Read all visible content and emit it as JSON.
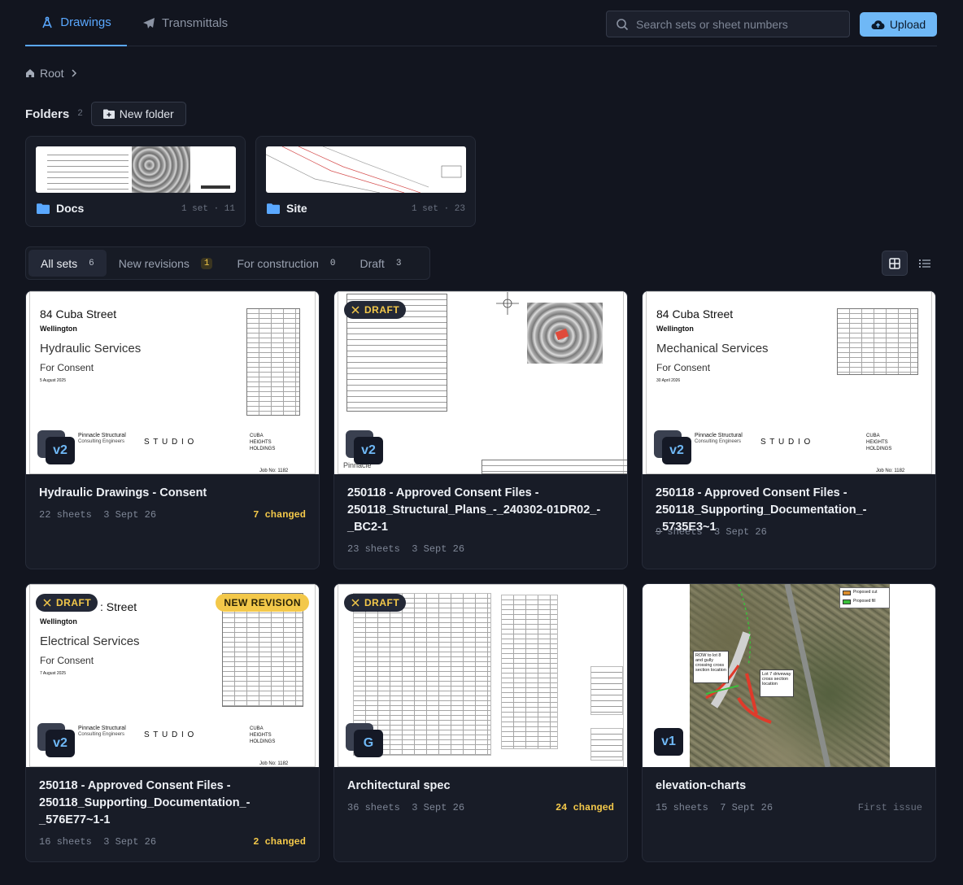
{
  "tabs": [
    {
      "label": "Drawings",
      "icon": "compass-icon",
      "active": true
    },
    {
      "label": "Transmittals",
      "icon": "paper-plane-icon",
      "active": false
    }
  ],
  "search": {
    "placeholder": "Search sets or sheet numbers"
  },
  "upload": {
    "label": "Upload"
  },
  "breadcrumb": {
    "root": "Root"
  },
  "folders": {
    "title": "Folders",
    "count": "2",
    "new_folder_label": "New folder",
    "items": [
      {
        "name": "Docs",
        "meta": "1 set · 11"
      },
      {
        "name": "Site",
        "meta": "1 set · 23"
      }
    ]
  },
  "filters": [
    {
      "label": "All sets",
      "count": "6",
      "active": true
    },
    {
      "label": "New revisions",
      "count": "1",
      "active": false
    },
    {
      "label": "For construction",
      "count": "0",
      "active": false
    },
    {
      "label": "Draft",
      "count": "3",
      "active": false
    }
  ],
  "badges": {
    "draft": "DRAFT",
    "new_revision": "NEW REVISION"
  },
  "sheet_text": {
    "address": "84 Cuba Street",
    "address_partial": ": Street",
    "city": "Wellington",
    "for_consent": "For Consent",
    "date_hyd": "5 August 2025",
    "date_mech": "30 April 2026",
    "date_elec": "7 August 2025",
    "hydraulic": "Hydraulic Services",
    "mechanical": "Mechanical Services",
    "electrical": "Electrical Services",
    "pinnacle": "Pinnacle Structural",
    "consulting": "Consulting Engineers",
    "studio": "S T U D I O",
    "cuba1": "CUBA",
    "cuba2": "HEIGHTS",
    "cuba3": "HOLDINGS",
    "job": "Job No: 1182",
    "pinnacle_short": "Pinnacle",
    "proposed_cut": "Proposed cut",
    "proposed_fill": "Proposed fill",
    "row_note": "ROW to lot 8 and gully crossing cross section location",
    "lot_note": "Lot 7 driveway cross section location"
  },
  "cards": [
    {
      "title": "Hydraulic Drawings - Consent",
      "sheets": "22 sheets",
      "date": "3 Sept 26",
      "changed": "7 changed",
      "version": "v2"
    },
    {
      "title": "250118 - Approved Consent Files - 250118_Structural_Plans_-_240302-01DR02_-_BC2-1",
      "sheets": "23 sheets",
      "date": "3 Sept 26",
      "changed": "",
      "version": "v2"
    },
    {
      "title": "250118 - Approved Consent Files - 250118_Supporting_Documentation_-_5735E3~1",
      "sheets": "9 sheets",
      "date": "3 Sept 26",
      "changed": "",
      "version": "v2"
    },
    {
      "title": "250118 - Approved Consent Files - 250118_Supporting_Documentation_-_576E77~1-1",
      "sheets": "16 sheets",
      "date": "3 Sept 26",
      "changed": "2 changed",
      "version": "v2"
    },
    {
      "title": "Architectural spec",
      "sheets": "36 sheets",
      "date": "3 Sept 26",
      "changed": "24 changed",
      "version": "G"
    },
    {
      "title": "elevation-charts",
      "sheets": "15 sheets",
      "date": "7 Sept 26",
      "changed": "",
      "status": "First issue",
      "version": "v1"
    }
  ],
  "colors": {
    "accent": "#5aa8ff",
    "upload_bg": "#6fb8f6",
    "draft": "#f3c84a",
    "background": "#12151f"
  }
}
